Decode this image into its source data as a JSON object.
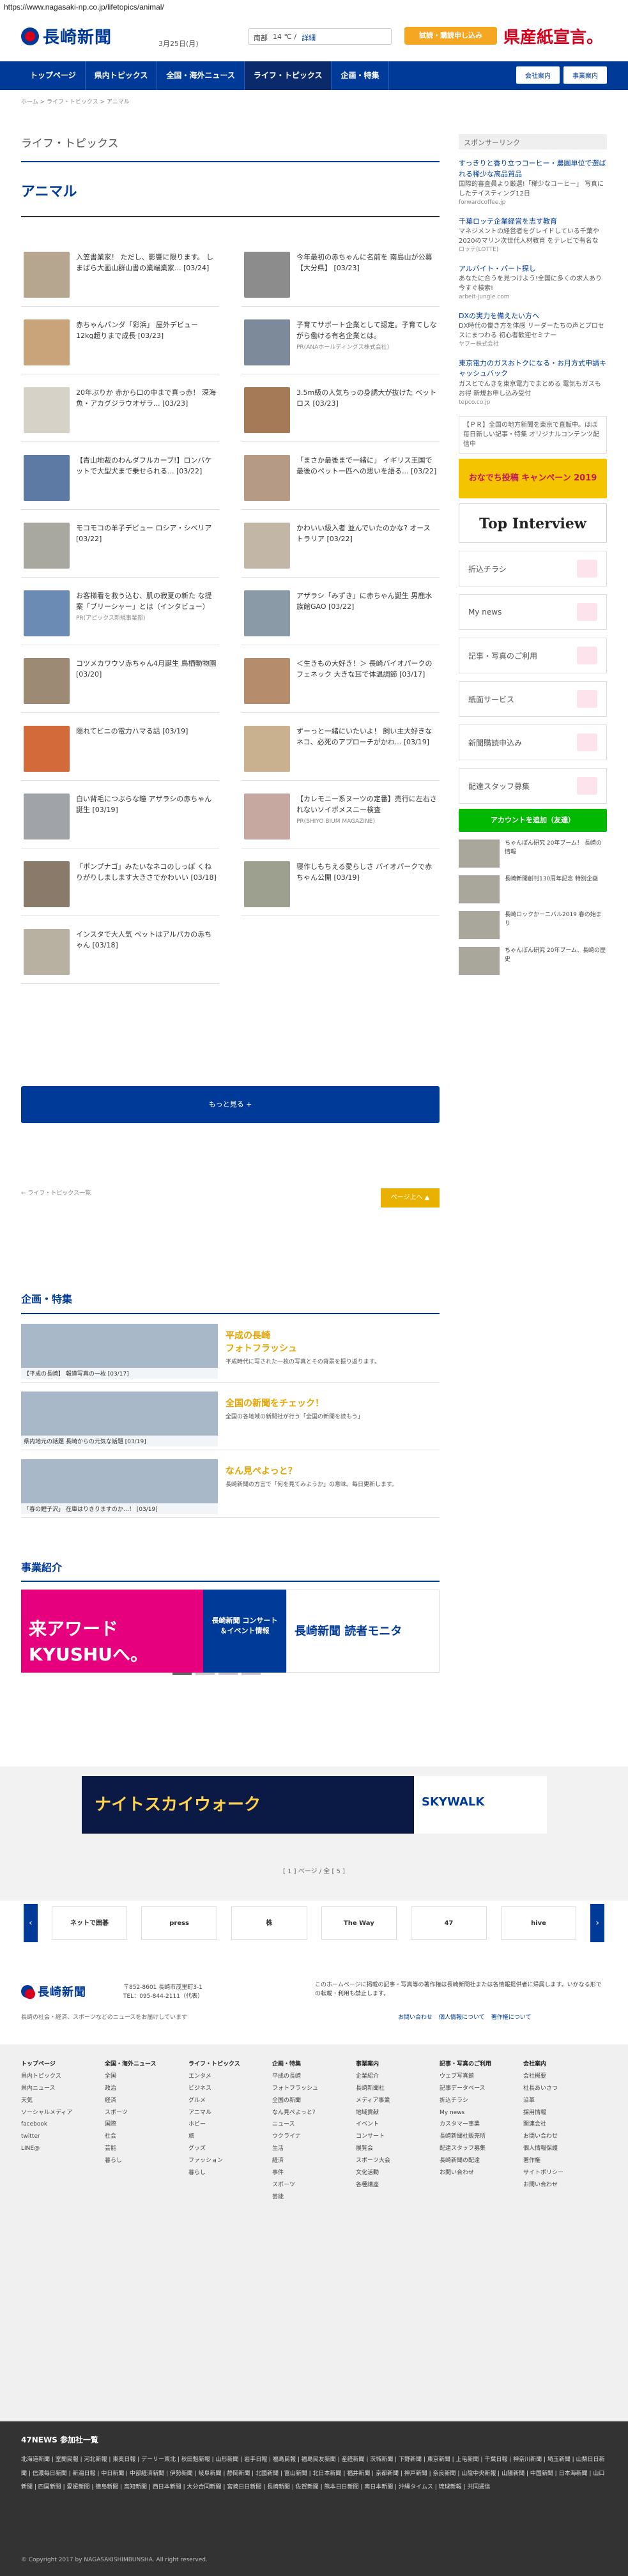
{
  "url": "https://www.nagasaki-np.co.jp/lifetopics/animal/",
  "header": {
    "logo_text": "長崎新聞",
    "date": "3月25日(月)",
    "weather_region": "南部",
    "weather_temp": "14 ℃ /",
    "weather_link": "詳細",
    "trial_label": "試読・購読申し込み",
    "promo_a": "県産紙",
    "promo_b": "宣言。"
  },
  "nav": {
    "items": [
      "トップページ",
      "県内トピックス",
      "全国・海外ニュース",
      "ライフ・トピックス",
      "企画・特集"
    ],
    "active_index": 3,
    "company_label": "会社案内",
    "business_label": "事業案内"
  },
  "breadcrumb": "ホーム > ライフ・トピックス > アニマル",
  "section_title": "ライフ・トピックス",
  "category": "アニマル",
  "articles": [
    {
      "title": "入笠書業家！ ただし、影響に限ります。 しまばら大画山群山書の業端業家... [03/24]",
      "pr": ""
    },
    {
      "title": "今年最初の赤ちゃんに名前を 南島山が公募【大分県】 [03/23]",
      "pr": ""
    },
    {
      "title": "赤ちゃんパンダ「彩浜」 屋外デビュー 12kg超りまで成長 [03/23]",
      "pr": ""
    },
    {
      "title": "子育てサポート企業として認定。子育てしながら働ける有名企業とは。",
      "pr": "PR(ANAホールディングス株式会社)"
    },
    {
      "title": "20年ぶりか 赤から口の中まで真っ赤！ 深海魚・アカグジラウオザラ... [03/23]",
      "pr": ""
    },
    {
      "title": "3.5m級の人気ちっの身誘大が抜けた ベットロス [03/23]",
      "pr": ""
    },
    {
      "title": "【青山地裁のわんダフルカーブ!】ロンバケットで大型犬まで乗せられる... [03/22]",
      "pr": ""
    },
    {
      "title": "「まさか最後まで一緒に」 イギリス王国で最後のペット一匹への思いを語る... [03/22]",
      "pr": ""
    },
    {
      "title": "モコモコの羊子デビュー ロシア・シベリア [03/22]",
      "pr": ""
    },
    {
      "title": "かわいい級入者 並んでいたのかな? オーストラリア [03/22]",
      "pr": ""
    },
    {
      "title": "お客様看を救う込む、肌の寂夏の新た な提案「ブリーシャー」とは（インタビュー）",
      "pr": "PR(アピックス新規事業部)"
    },
    {
      "title": "アザラシ「みずき」に赤ちゃん誕生 男鹿水族館GAO [03/22]",
      "pr": ""
    },
    {
      "title": "コツメカワウソ赤ちゃん4月誕生 鳥栖動物園 [03/20]",
      "pr": ""
    },
    {
      "title": "＜生きもの大好き！＞ 長崎バイオパークのフェネック 大きな耳で体温調節 [03/17]",
      "pr": ""
    },
    {
      "title": "隠れてビニの電力ハマる話 [03/19]",
      "pr": ""
    },
    {
      "title": "ずーっと一緒にいたいよ！ 飼い主大好きなネコ、必死のアプローチがかわ... [03/19]",
      "pr": ""
    },
    {
      "title": "白い背毛につぶらな瞳 アザラシの赤ちゃん誕生 [03/19]",
      "pr": ""
    },
    {
      "title": "【カレモニー系ヌーツの定番】売行に左右されないソイポメスニー検査",
      "pr": "PR(SHIYO BIUM MAGAZINE)"
    },
    {
      "title": "「ポンプナゴ」みたいなネコのしっぽ くねりがりしまします大きさでかわいい [03/18]",
      "pr": ""
    },
    {
      "title": "寝作しもちえる愛らしさ バイオパークで赤ちゃん公開 [03/19]",
      "pr": ""
    },
    {
      "title": "インスタで大人気 ペットはアルパカの赤ちゃん [03/18]",
      "pr": ""
    }
  ],
  "more_label": "もっと見る +",
  "pager": {
    "back": "← ライフ・トピックス一覧",
    "up": "ページ上へ ▲"
  },
  "sidebar": {
    "sponsor": "スポンサーリンク",
    "ads": [
      {
        "title": "すっきりと香り立つコーヒー・農園単位で選ばれる稀少な高品質品",
        "desc": "国際的審査員より厳選!「稀少なコーヒー」 写真にしたテイスティング12日",
        "url": "forwardcoffee.jp"
      },
      {
        "title": "千葉ロッテ企業経営を志す教育",
        "desc": "マネジメントの経営者をグレイドしている千葉や 2020のマリン次世代人材教育 をテレビで有名な",
        "url": "ロッテ(LOTTE)"
      },
      {
        "title": "アルバイト・パート探し",
        "desc": "あなたに合うを見つけよう!全国に多くの求人あり 今すぐ検索!",
        "url": "arbeit-jungle.com"
      },
      {
        "title": "DXの実力を備えたい方へ",
        "desc": "DX時代の働き方を体感 リーダーたちの声とプロセスにまつわる 初心者歓迎セミナー",
        "url": "ヤフー株式会社"
      },
      {
        "title": "東京電力のガスおトクになる・お月方式申請キャッシュバック",
        "desc": "ガスとでんきを東京電力でまとめる 電気もガスもお得 新規お申し込み受付",
        "url": "tepco.co.jp"
      }
    ],
    "notice": "【ＰＲ】全国の地方新聞を東京で直販中。ほぼ毎日新しい記事・特集 オリジナルコンテンツ配信中",
    "banner_interview": "Top Interview",
    "banner_campaign": "おなでち投稿 キャンペーン 2019",
    "links": [
      "折込チラシ",
      "My news",
      "記事・写真のご利用",
      "紙面サービス",
      "新聞購読申込み",
      "配達スタッフ募集"
    ],
    "line_label": "アカウントを追加（友達）",
    "bottom_items": [
      "ちゃんぽん研究 20年ブーム！ 長崎の情報",
      "長崎新聞創刊130周年記念 特別企画",
      "長崎ロックかーニバル2019 春の始まり",
      "ちゃんぽん研究 20年ブーム、長崎の歴史"
    ]
  },
  "feature": {
    "title": "企画・特集",
    "items": [
      {
        "caption": "【平成の長崎】 報道写真の一枚 [03/17]",
        "title": "平成の長崎\nフォトフラッシュ",
        "desc": "平成時代に写された一枚の写真とその背景を振り返ります。"
      },
      {
        "caption": "県内地元の話題 長崎からの元気な話題 [03/19]",
        "title": "全国の新聞をチェック！",
        "desc": "全国の各地域の新聞社が行う「全国の新聞を読もう」"
      },
      {
        "caption": "「春の鯉子沢」 在庫はりきりますのか…！ [03/19]",
        "title": "なん見ぺよっと？",
        "desc": "長崎新聞の方言で「何を見てみようか」の意味。毎日更新します。"
      }
    ]
  },
  "business": {
    "title": "事業紹介",
    "slides": [
      "来アワード KYUSHUへ。",
      "長崎新聞 コンサート＆イベント情報",
      "長崎新聞 読者モニタ"
    ]
  },
  "ad_banner": {
    "left": "ナイトスカイウォーク",
    "right": "SKYWALK"
  },
  "page_indicator": "[ 1 ] ページ / 全 [ 5 ]",
  "partners": [
    "ネットで囲碁",
    "press",
    "株",
    "The Way",
    "47",
    "hive"
  ],
  "footer": {
    "logo": "長崎新聞",
    "address": "〒852-8601 長崎市茂里町3-1\nTEL：095-844-2111（代表）",
    "desc": "長崎の社会・経済、スポーツなどのニュースをお届けしています",
    "notice": "このホームページに掲載の記事・写真等の著作権は長崎新聞社または各情報提供者に帰属します。いかなる形での転載・利用も禁止します。",
    "links2": [
      "お問い合わせ",
      "個人情報について",
      "著作権について"
    ],
    "cols": [
      {
        "head": "トップページ",
        "items": [
          "県内トピックス",
          "県内ニュース",
          "天気",
          "ソーシャルメディア",
          "facebook",
          "twitter",
          "LINE@"
        ]
      },
      {
        "head": "全国・海外ニュース",
        "items": [
          "全国",
          "政治",
          "経済",
          "スポーツ",
          "国際",
          "社会",
          "芸能",
          "暮らし"
        ]
      },
      {
        "head": "ライフ・トピックス",
        "items": [
          "エンタメ",
          "ビジネス",
          "グルメ",
          "アニマル",
          "ホビー",
          "旅",
          "グッズ",
          "ファッション",
          "暮らし"
        ]
      },
      {
        "head": "企画・特集",
        "items": [
          "平成の長崎",
          "フォトフラッシュ",
          "全国の新聞",
          "なん見ぺよっと？",
          "ニュース",
          "ウクライナ",
          "生活",
          "経済",
          "事件",
          "スポーツ",
          "芸能"
        ]
      },
      {
        "head": "事業案内",
        "items": [
          "企業紹介",
          "長崎新聞社",
          "メディア事業",
          "地域貢献",
          "イベント",
          "コンサート",
          "展覧会",
          "スポーツ大会",
          "文化活動",
          "各種講座"
        ]
      },
      {
        "head": "記事・写真のご利用",
        "items": [
          "ウェブ写真館",
          "記事データベース",
          "折込チラシ",
          "My news",
          "カスタマー事業",
          "長崎新聞社販売所",
          "配達スタッフ募集",
          "長崎新聞の配達",
          "お問い合わせ"
        ]
      },
      {
        "head": "会社案内",
        "items": [
          "会社概要",
          "社長あいさつ",
          "沿革",
          "採用情報",
          "関連会社",
          "お問い合わせ",
          "個人情報保護",
          "著作権",
          "サイトポリシー",
          "お問い合わせ"
        ]
      }
    ],
    "network_title": "47NEWS 参加社一覧",
    "network": "北海道新聞 | 室蘭民報 | 河北新報 | 東奥日報 | デーリー東北 | 秋田魁新報 | 山形新聞 | 岩手日報 | 福島民報 | 福島民友新聞 | 産経新聞 | 茨城新聞 | 下野新聞 | 東京新聞 | 上毛新聞 | 千葉日報 | 神奈川新聞 | 埼玉新聞 | 山梨日日新聞 | 信濃毎日新聞 | 新潟日報 | 中日新聞 | 中部経済新聞 | 伊勢新聞 | 岐阜新聞 | 静岡新聞 | 北國新聞 | 富山新聞 | 北日本新聞 | 福井新聞 | 京都新聞 | 神戸新聞 | 奈良新聞 | 山陰中央新報 | 山陽新聞 | 中国新聞 | 日本海新聞 | 山口新聞 | 四国新聞 | 愛媛新聞 | 徳島新聞 | 高知新聞 | 西日本新聞 | 大分合同新聞 | 宮崎日日新聞 | 長崎新聞 | 佐賀新聞 | 熊本日日新聞 | 南日本新聞 | 沖縄タイムス | 琉球新報 | 共同通信",
    "copyright": "© Copyright 2017 by NAGASAKISHIMBUNSHA. All right reserved."
  },
  "colors": {
    "brand": "#003a99",
    "accent": "#d6001c",
    "highlight": "#e5a400"
  }
}
